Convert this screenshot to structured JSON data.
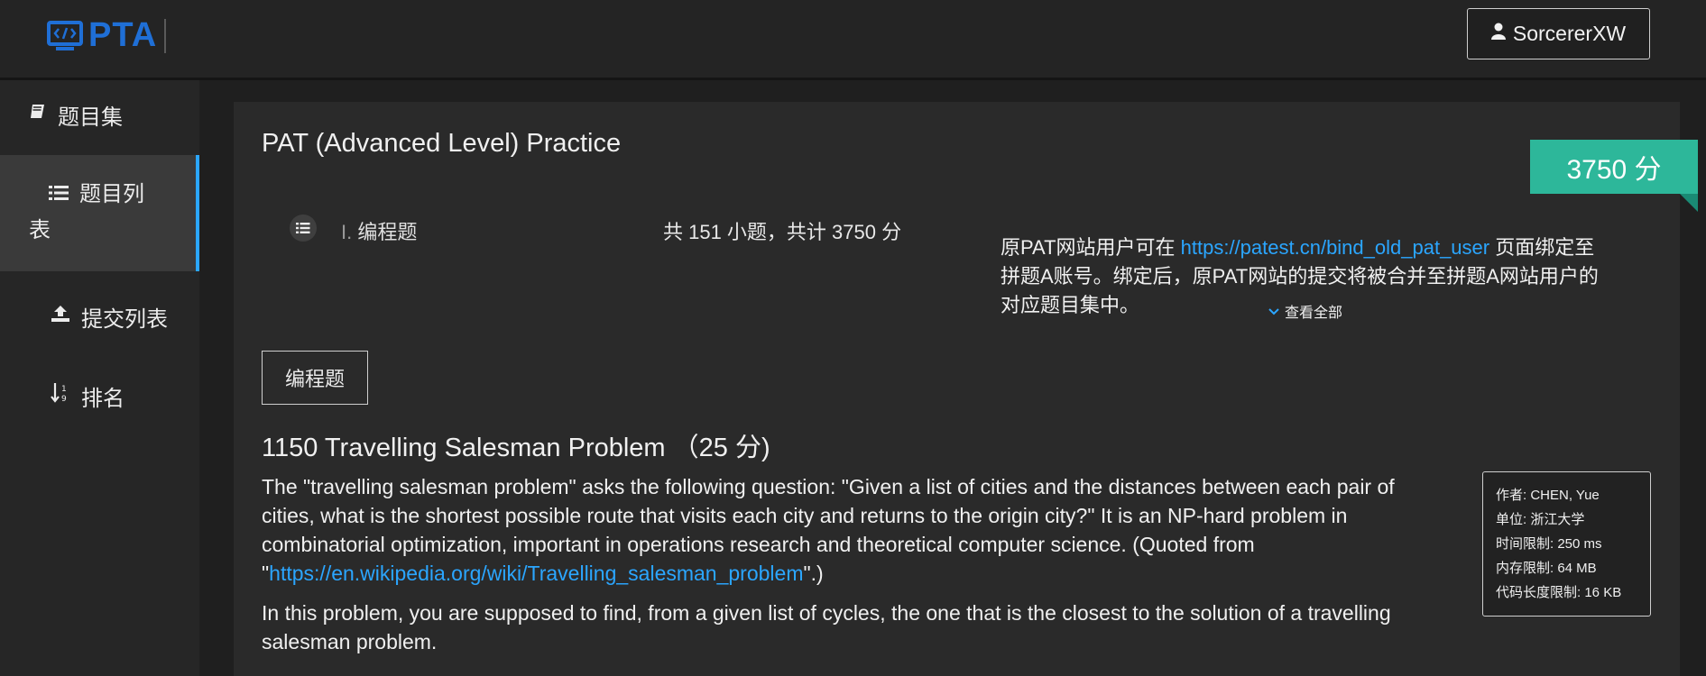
{
  "header": {
    "logo_text": "PTA",
    "user_name": "SorcererXW"
  },
  "sidebar": {
    "items": [
      {
        "label": "题目集",
        "icon": "book-icon"
      },
      {
        "label": "题目列表",
        "icon": "list-icon"
      },
      {
        "label": "提交列表",
        "icon": "upload-icon"
      },
      {
        "label": "排名",
        "icon": "sort-numeric-icon"
      }
    ]
  },
  "main": {
    "title": "PAT (Advanced Level) Practice",
    "score_badge": "3750 分",
    "section": {
      "index": "I.",
      "label": "编程题",
      "summary": "共 151 小题，共计 3750 分"
    },
    "notice": {
      "prefix": "原PAT网站用户可在 ",
      "link": "https://patest.cn/bind_old_pat_user",
      "suffix": " 页面绑定至拼题A账号。绑定后，原PAT网站的提交将被合并至拼题A网站用户的对应题目集中。",
      "view_all": "查看全部"
    },
    "tab_label": "编程题",
    "problem": {
      "title": "1150 Travelling Salesman Problem （25 分)",
      "para1_text": "The \"travelling salesman problem\" asks the following question: \"Given a list of cities and the distances between each pair of cities, what is the shortest possible route that visits each city and returns to the origin city?\" It is an NP-hard problem in combinatorial optimization, important in operations research and theoretical computer science. (Quoted from \"",
      "para1_link": "https://en.wikipedia.org/wiki/Travelling_salesman_problem",
      "para1_end": "\".)",
      "para2": "In this problem, you are supposed to find, from a given list of cycles, the one that is the closest to the solution of a travelling salesman problem."
    },
    "info": {
      "author": "作者: CHEN, Yue",
      "unit": "单位: 浙江大学",
      "time_limit": "时间限制: 250 ms",
      "memory_limit": "内存限制: 64 MB",
      "code_limit": "代码长度限制: 16 KB"
    }
  },
  "colors": {
    "accent": "#2ba6ff",
    "badge": "#2db79a",
    "logo": "#1f6fd6"
  }
}
